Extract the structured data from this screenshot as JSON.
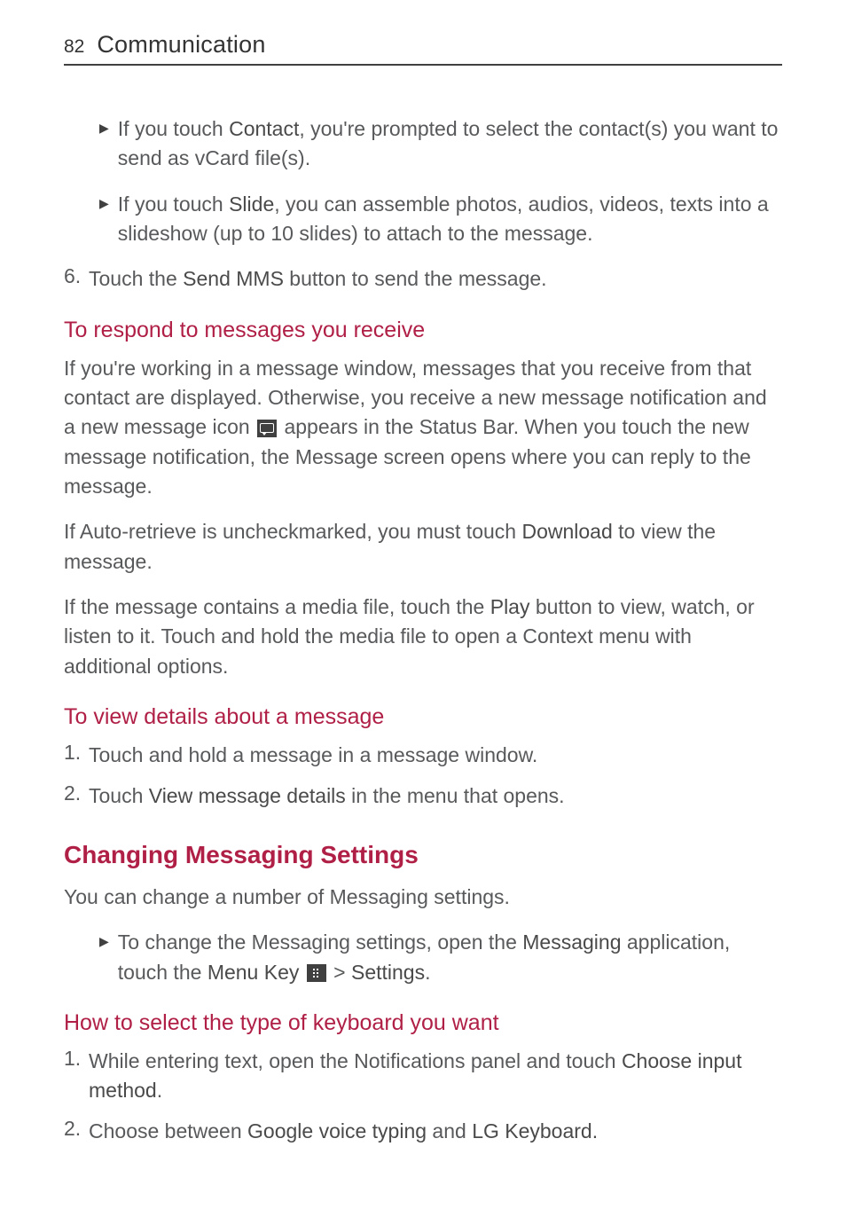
{
  "header": {
    "page_number": "82",
    "title": "Communication"
  },
  "bullets": {
    "contact": {
      "pre": "If you touch ",
      "bold": "Contact",
      "post": ", you're prompted to select the contact(s) you want to send as vCard file(s)."
    },
    "slide": {
      "pre": "If you touch ",
      "bold": "Slide",
      "post": ", you can assemble photos, audios, videos, texts into a slideshow (up to 10 slides) to attach to the message."
    }
  },
  "step6": {
    "num": "6.",
    "pre": "Touch the ",
    "bold": "Send MMS",
    "post": " button to send the message."
  },
  "respond": {
    "heading": "To respond to messages you receive",
    "p1_pre": "If you're working in a message window, messages that you receive from that contact are displayed. Otherwise, you receive a new message notification and a new message icon ",
    "p1_post": " appears in the Status Bar. When you touch the new message notification, the Message screen opens where you can reply to the message.",
    "p2_pre": "If Auto-retrieve is uncheckmarked, you must touch ",
    "p2_bold": "Download",
    "p2_post": " to view the message.",
    "p3_pre": "If the message contains a media file, touch the ",
    "p3_bold": "Play",
    "p3_post": " button to view, watch, or listen to it. Touch and hold the media file to open a Context menu with additional options."
  },
  "details": {
    "heading": "To view details about a message",
    "s1_num": "1.",
    "s1_text": "Touch and hold a message in a message window.",
    "s2_num": "2.",
    "s2_pre": "Touch ",
    "s2_bold": "View message details",
    "s2_post": " in the menu that opens."
  },
  "changing": {
    "heading": "Changing Messaging Settings",
    "intro": "You can change a number of Messaging settings.",
    "bullet_pre": "To change the Messaging settings, open the ",
    "bullet_bold1": "Messaging",
    "bullet_mid1": " application, touch the ",
    "bullet_bold2": "Menu Key",
    "bullet_mid2": " ",
    "bullet_gt": " > ",
    "bullet_bold3": "Settings",
    "bullet_post": "."
  },
  "keyboard": {
    "heading": "How to select the type of keyboard you want",
    "s1_num": "1.",
    "s1_pre": "While entering text, open the Notifications panel and touch ",
    "s1_bold": "Choose input method",
    "s1_post": ".",
    "s2_num": "2.",
    "s2_pre": "Choose between ",
    "s2_bold1": "Google voice typing",
    "s2_mid": " and ",
    "s2_bold2": "LG Keyboard.",
    "s2_post": ""
  }
}
